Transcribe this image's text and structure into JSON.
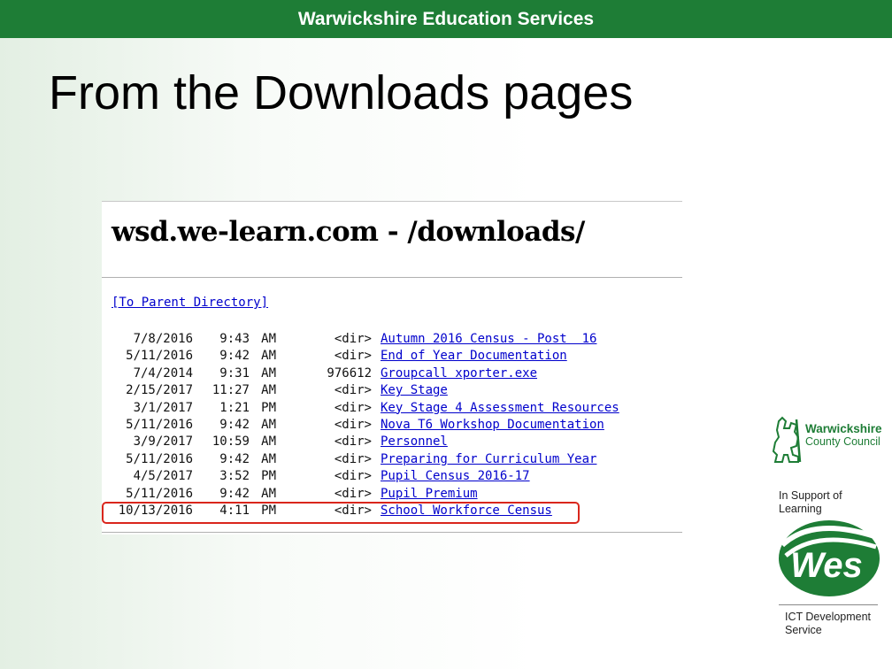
{
  "banner": {
    "title": "Warwickshire Education Services"
  },
  "slide": {
    "title": "From the Downloads pages"
  },
  "screenshot": {
    "heading": "wsd.we-learn.com - /downloads/",
    "parent_link": "[To Parent Directory]",
    "rows": [
      {
        "date": "7/8/2016",
        "time": "9:43",
        "ampm": "AM",
        "size": "<dir>",
        "name": "Autumn 2016 Census - Post  16"
      },
      {
        "date": "5/11/2016",
        "time": "9:42",
        "ampm": "AM",
        "size": "<dir>",
        "name": "End of Year Documentation"
      },
      {
        "date": "7/4/2014",
        "time": "9:31",
        "ampm": "AM",
        "size": "976612",
        "name": "Groupcall xporter.exe"
      },
      {
        "date": "2/15/2017",
        "time": "11:27",
        "ampm": "AM",
        "size": "<dir>",
        "name": "Key Stage"
      },
      {
        "date": "3/1/2017",
        "time": "1:21",
        "ampm": "PM",
        "size": "<dir>",
        "name": "Key Stage 4 Assessment Resources"
      },
      {
        "date": "5/11/2016",
        "time": "9:42",
        "ampm": "AM",
        "size": "<dir>",
        "name": "Nova T6 Workshop Documentation"
      },
      {
        "date": "3/9/2017",
        "time": "10:59",
        "ampm": "AM",
        "size": "<dir>",
        "name": "Personnel"
      },
      {
        "date": "5/11/2016",
        "time": "9:42",
        "ampm": "AM",
        "size": "<dir>",
        "name": "Preparing for Curriculum Year"
      },
      {
        "date": "4/5/2017",
        "time": "3:52",
        "ampm": "PM",
        "size": "<dir>",
        "name": "Pupil Census 2016-17"
      },
      {
        "date": "5/11/2016",
        "time": "9:42",
        "ampm": "AM",
        "size": "<dir>",
        "name": "Pupil Premium"
      },
      {
        "date": "10/13/2016",
        "time": "4:11",
        "ampm": "PM",
        "size": "<dir>",
        "name": "School Workforce Census"
      }
    ],
    "highlighted_row": "School Workforce Census"
  },
  "sidebar": {
    "council_name_line1": "Warwickshire",
    "council_name_line2": "County Council",
    "support_text": "In Support of Learning",
    "wes_logo_text": "Wes",
    "ict_text": "ICT Development Service"
  },
  "colors": {
    "brand_green": "#1e7d36",
    "link_blue": "#0000cc",
    "highlight_red": "#d9261c"
  },
  "icons": [
    "bear-and-ragged-staff-icon",
    "wes-logo-icon"
  ]
}
